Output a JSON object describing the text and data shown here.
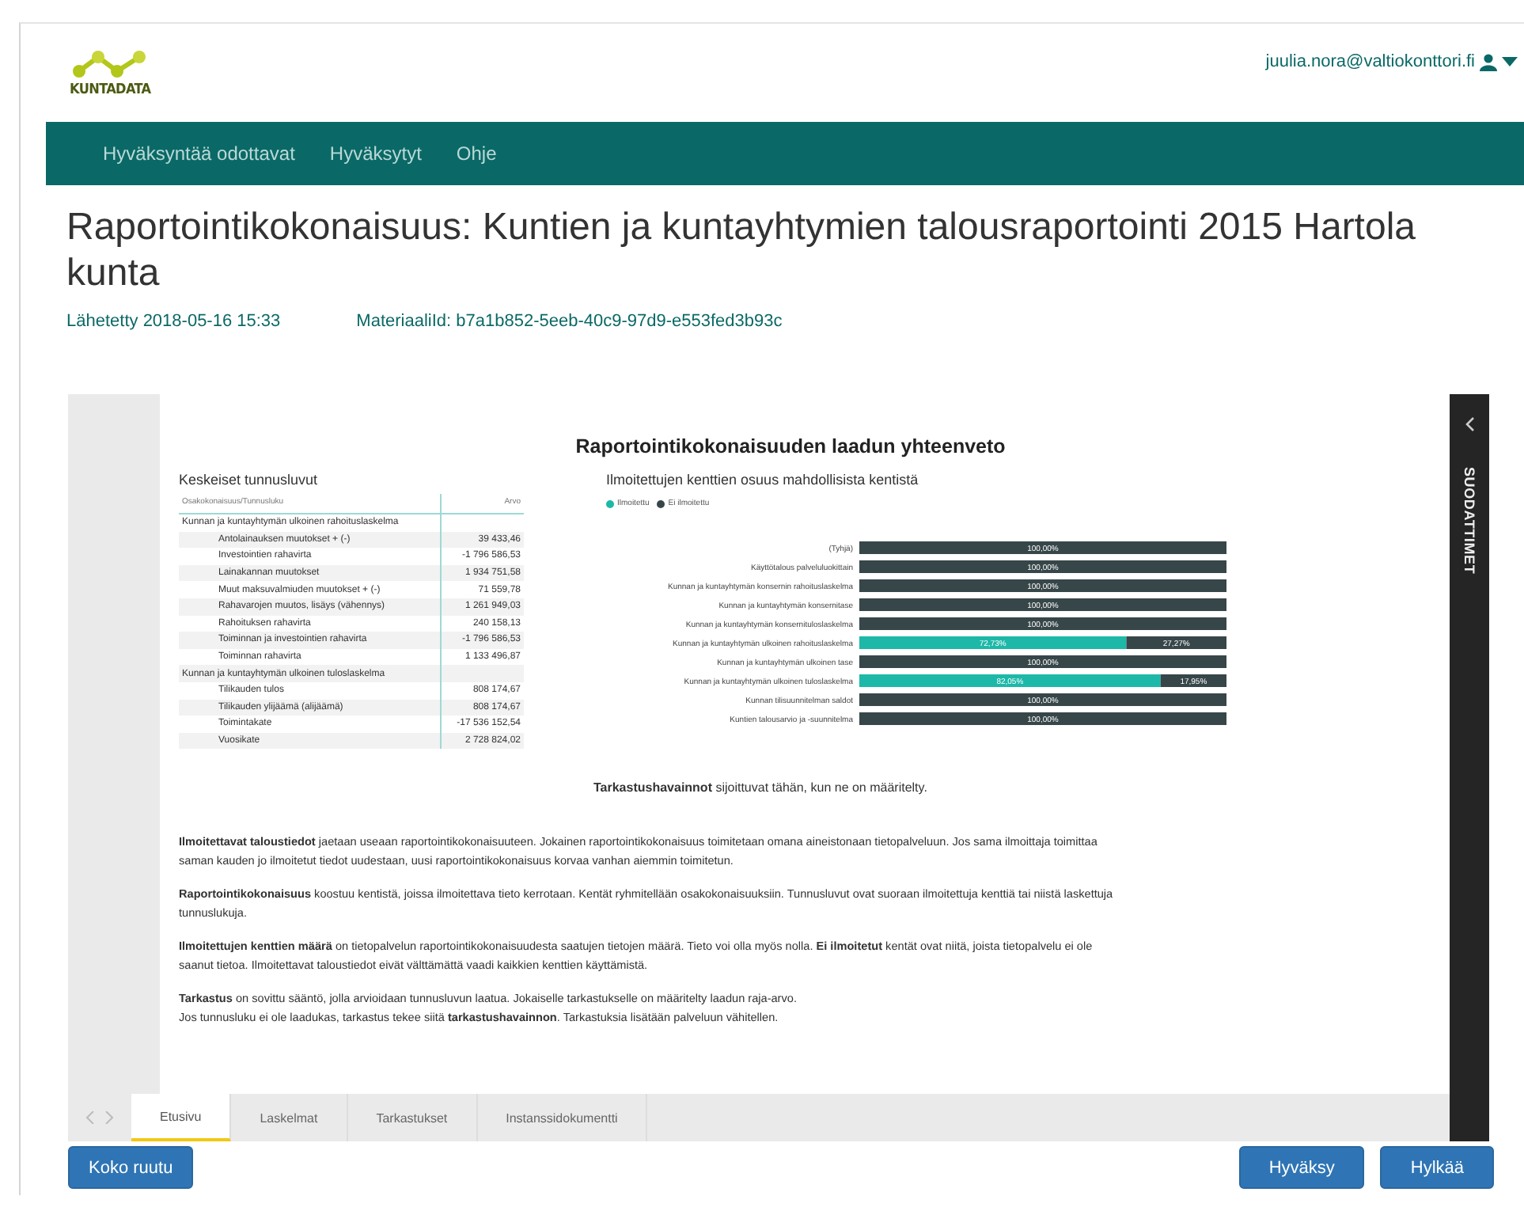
{
  "header": {
    "logo_text": "KUNTADATA",
    "user": "juulia.nora@valtiokonttori.fi"
  },
  "nav": [
    {
      "label": "Hyväksyntää odottavat"
    },
    {
      "label": "Hyväksytyt"
    },
    {
      "label": "Ohje"
    }
  ],
  "title": "Raportointikokonaisuus: Kuntien ja kuntayhtymien talousraportointi 2015 Hartola kunta",
  "meta": [
    "Lähetetty 2018-05-16 15:33",
    "MateriaaliId: b7a1b852-5eeb-40c9-97d9-e553fed3b93c"
  ],
  "report": {
    "heading": "Raportointikokonaisuuden laadun yhteenveto",
    "table": {
      "title": "Keskeiset tunnusluvut",
      "columns": [
        "Osakokonaisuus/Tunnusluku",
        "Arvo"
      ],
      "rows": [
        {
          "kind": "group",
          "label": "Kunnan ja kuntayhtymän ulkoinen rahoituslaskelma"
        },
        {
          "kind": "item",
          "label": "Antolainauksen muutokset + (-)",
          "value": "39 433,46"
        },
        {
          "kind": "item",
          "label": "Investointien rahavirta",
          "value": "-1 796 586,53"
        },
        {
          "kind": "item",
          "label": "Lainakannan muutokset",
          "value": "1 934 751,58"
        },
        {
          "kind": "item",
          "label": "Muut maksuvalmiuden muutokset + (-)",
          "value": "71 559,78"
        },
        {
          "kind": "item",
          "label": "Rahavarojen muutos, lisäys (vähennys)",
          "value": "1 261 949,03"
        },
        {
          "kind": "item",
          "label": "Rahoituksen rahavirta",
          "value": "240 158,13"
        },
        {
          "kind": "item",
          "label": "Toiminnan ja investointien rahavirta",
          "value": "-1 796 586,53"
        },
        {
          "kind": "item",
          "label": "Toiminnan rahavirta",
          "value": "1 133 496,87"
        },
        {
          "kind": "group",
          "label": "Kunnan ja kuntayhtymän ulkoinen tuloslaskelma"
        },
        {
          "kind": "item",
          "label": "Tilikauden tulos",
          "value": "808 174,67"
        },
        {
          "kind": "item",
          "label": "Tilikauden ylijäämä (alijäämä)",
          "value": "808 174,67"
        },
        {
          "kind": "item",
          "label": "Toimintakate",
          "value": "-17 536 152,54"
        },
        {
          "kind": "item",
          "label": "Vuosikate",
          "value": "2 728 824,02"
        }
      ]
    },
    "chart_data": {
      "type": "bar",
      "orientation": "horizontal",
      "stacked": true,
      "title": "Ilmoitettujen kenttien osuus mahdollisista kentistä",
      "legend": true,
      "categories": [
        "(Tyhjä)",
        "Käyttötalous palveluluokittain",
        "Kunnan ja kuntayhtymän konsernin rahoituslaskelma",
        "Kunnan ja kuntayhtymän konsernitase",
        "Kunnan ja kuntayhtymän konsernituloslaskelma",
        "Kunnan ja kuntayhtymän ulkoinen rahoituslaskelma",
        "Kunnan ja kuntayhtymän ulkoinen tase",
        "Kunnan ja kuntayhtymän ulkoinen tuloslaskelma",
        "Kunnan tilisuunnitelman saldot",
        "Kuntien talousarvio ja -suunnitelma"
      ],
      "series": [
        {
          "name": "Ilmoitettu",
          "color": "#1db8a8",
          "values": [
            0,
            0,
            0,
            0,
            0,
            72.73,
            0,
            82.05,
            0,
            0
          ],
          "value_labels": [
            null,
            null,
            null,
            null,
            null,
            "72,73%",
            null,
            "82,05%",
            null,
            null
          ]
        },
        {
          "name": "Ei ilmoitettu",
          "color": "#374649",
          "values": [
            100,
            100,
            100,
            100,
            100,
            27.27,
            100,
            17.95,
            100,
            100
          ],
          "value_labels": [
            "100,00%",
            "100,00%",
            "100,00%",
            "100,00%",
            "100,00%",
            "27,27%",
            "100,00%",
            "17,95%",
            "100,00%",
            "100,00%"
          ]
        }
      ]
    },
    "note": "**Tarkastushavainnot** sijoittuvat tähän, kun ne on määritelty.",
    "paragraphs": [
      "**Ilmoitettavat taloustiedot** jaetaan useaan raportointikokonaisuuteen. Jokainen raportointikokonaisuus toimitetaan omana aineistonaan tietopalveluun. Jos sama ilmoittaja toimittaa saman kauden jo ilmoitetut tiedot uudestaan, uusi raportointikokonaisuus korvaa vanhan aiemmin toimitetun.",
      "**Raportointikokonaisuus** koostuu kentistä, joissa ilmoitettava tieto kerrotaan. Kentät ryhmitellään osakokonaisuuksiin. Tunnusluvut ovat suoraan ilmoitettuja kenttiä tai niistä laskettuja tunnuslukuja.",
      "**Ilmoitettujen kenttien määrä** on tietopalvelun raportointikokonaisuudesta saatujen tietojen määrä. Tieto voi olla myös nolla. **Ei ilmoitetut** kentät ovat niitä, joista tietopalvelu ei ole saanut tietoa. Ilmoitettavat taloustiedot eivät välttämättä vaadi kaikkien kenttien käyttämistä.",
      "**Tarkastus** on sovittu sääntö, jolla arvioidaan tunnusluvun laatua. Jokaiselle tarkastukselle on määritelty laadun raja-arvo.\nJos tunnusluku ei ole laadukas, tarkastus tekee siitä **tarkastushavainnon**. Tarkastuksia lisätään palveluun vähitellen."
    ],
    "filter_panel": "SUODATTIMET",
    "tabs": [
      {
        "label": "Etusivu",
        "selected": true
      },
      {
        "label": "Laskelmat",
        "selected": false
      },
      {
        "label": "Tarkastukset",
        "selected": false
      },
      {
        "label": "Instanssidokumentti",
        "selected": false
      }
    ]
  },
  "buttons": {
    "left": [
      "Koko ruutu"
    ],
    "right": [
      "Hyväksy",
      "Hylkää"
    ]
  }
}
